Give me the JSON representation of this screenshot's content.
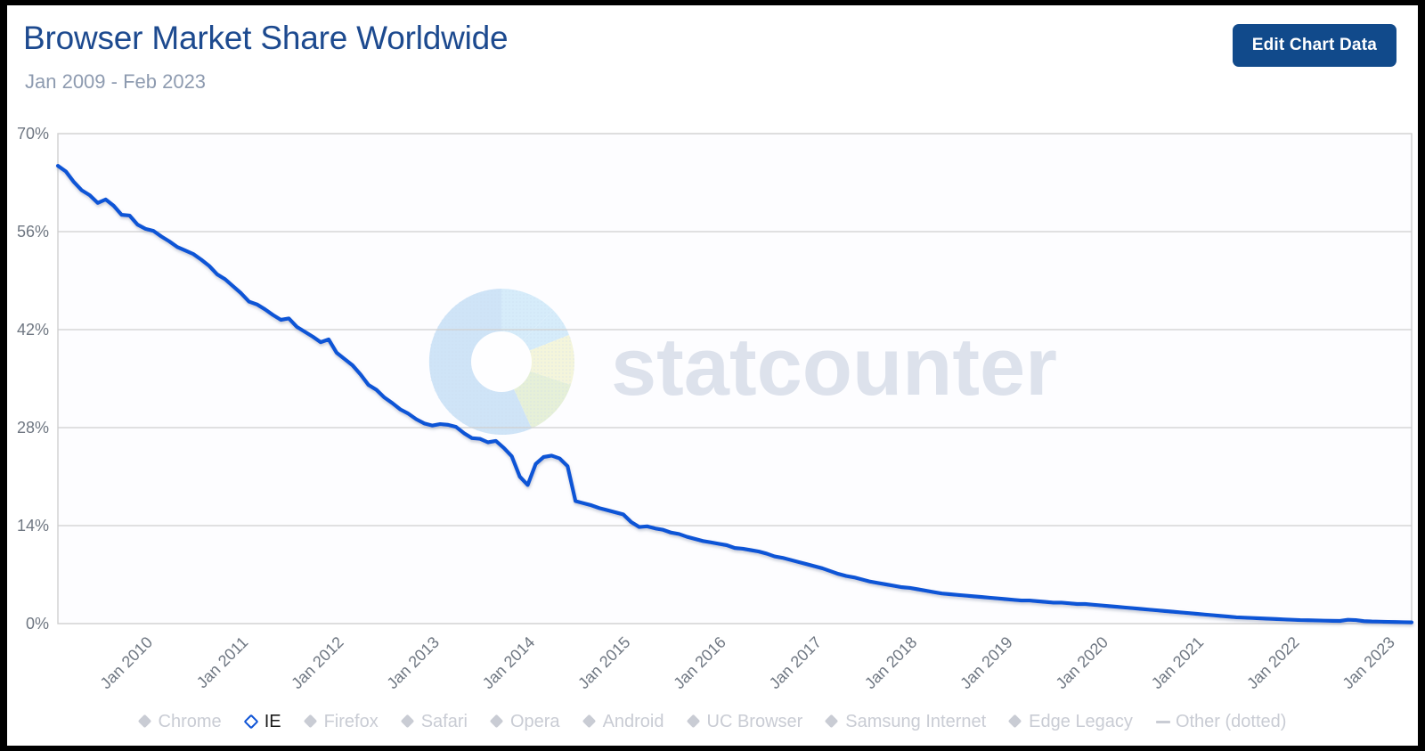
{
  "header": {
    "title": "Browser Market Share Worldwide",
    "subtitle": "Jan 2009 - Feb 2023",
    "edit_button_label": "Edit Chart Data"
  },
  "watermark": {
    "text": "statcounter"
  },
  "legend": {
    "items": [
      {
        "label": "Chrome",
        "marker": "diamond",
        "active": false
      },
      {
        "label": "IE",
        "marker": "diamond",
        "active": true
      },
      {
        "label": "Firefox",
        "marker": "diamond",
        "active": false
      },
      {
        "label": "Safari",
        "marker": "diamond",
        "active": false
      },
      {
        "label": "Opera",
        "marker": "diamond",
        "active": false
      },
      {
        "label": "Android",
        "marker": "diamond",
        "active": false
      },
      {
        "label": "UC Browser",
        "marker": "diamond",
        "active": false
      },
      {
        "label": "Samsung Internet",
        "marker": "diamond",
        "active": false
      },
      {
        "label": "Edge Legacy",
        "marker": "diamond",
        "active": false
      },
      {
        "label": "Other (dotted)",
        "marker": "dash",
        "active": false
      }
    ]
  },
  "colors": {
    "series_ie": "#0f54d6",
    "title": "#1d4a8f",
    "subtitle": "#8e9bb0",
    "button_bg": "#114a8b",
    "gridline": "#cfcfcf",
    "axis_text": "#6f7782",
    "legend_inactive": "#c9ccd4",
    "legend_active": "#1b1b1b",
    "plot_bg": "#fdfdff"
  },
  "chart_data": {
    "type": "line",
    "title": "Browser Market Share Worldwide",
    "subtitle": "Jan 2009 - Feb 2023",
    "xlabel": "",
    "ylabel": "",
    "ylim": [
      0,
      70
    ],
    "yticks": [
      "0%",
      "14%",
      "28%",
      "42%",
      "56%",
      "70%"
    ],
    "ytick_values": [
      0,
      14,
      28,
      42,
      56,
      70
    ],
    "xticks": [
      "Jan 2010",
      "Jan 2011",
      "Jan 2012",
      "Jan 2013",
      "Jan 2014",
      "Jan 2015",
      "Jan 2016",
      "Jan 2017",
      "Jan 2018",
      "Jan 2019",
      "Jan 2020",
      "Jan 2021",
      "Jan 2022",
      "Jan 2023"
    ],
    "grid": true,
    "legend_position": "bottom",
    "x_start": "Jan 2009",
    "x_end": "Feb 2023",
    "x_interval": "monthly",
    "series": [
      {
        "name": "IE",
        "color": "#0f54d6",
        "unit": "%",
        "x": [
          "2009-01",
          "2009-02",
          "2009-03",
          "2009-04",
          "2009-05",
          "2009-06",
          "2009-07",
          "2009-08",
          "2009-09",
          "2009-10",
          "2009-11",
          "2009-12",
          "2010-01",
          "2010-02",
          "2010-03",
          "2010-04",
          "2010-05",
          "2010-06",
          "2010-07",
          "2010-08",
          "2010-09",
          "2010-10",
          "2010-11",
          "2010-12",
          "2011-01",
          "2011-02",
          "2011-03",
          "2011-04",
          "2011-05",
          "2011-06",
          "2011-07",
          "2011-08",
          "2011-09",
          "2011-10",
          "2011-11",
          "2011-12",
          "2012-01",
          "2012-02",
          "2012-03",
          "2012-04",
          "2012-05",
          "2012-06",
          "2012-07",
          "2012-08",
          "2012-09",
          "2012-10",
          "2012-11",
          "2012-12",
          "2013-01",
          "2013-02",
          "2013-03",
          "2013-04",
          "2013-05",
          "2013-06",
          "2013-07",
          "2013-08",
          "2013-09",
          "2013-10",
          "2013-11",
          "2013-12",
          "2014-01",
          "2014-02",
          "2014-03",
          "2014-04",
          "2014-05",
          "2014-06",
          "2014-07",
          "2014-08",
          "2014-09",
          "2014-10",
          "2014-11",
          "2014-12",
          "2015-01",
          "2015-02",
          "2015-03",
          "2015-04",
          "2015-05",
          "2015-06",
          "2015-07",
          "2015-08",
          "2015-09",
          "2015-10",
          "2015-11",
          "2015-12",
          "2016-01",
          "2016-02",
          "2016-03",
          "2016-04",
          "2016-05",
          "2016-06",
          "2016-07",
          "2016-08",
          "2016-09",
          "2016-10",
          "2016-11",
          "2016-12",
          "2017-01",
          "2017-02",
          "2017-03",
          "2017-04",
          "2017-05",
          "2017-06",
          "2017-07",
          "2017-08",
          "2017-09",
          "2017-10",
          "2017-11",
          "2017-12",
          "2018-01",
          "2018-02",
          "2018-03",
          "2018-04",
          "2018-05",
          "2018-06",
          "2018-07",
          "2018-08",
          "2018-09",
          "2018-10",
          "2018-11",
          "2018-12",
          "2019-01",
          "2019-02",
          "2019-03",
          "2019-04",
          "2019-05",
          "2019-06",
          "2019-07",
          "2019-08",
          "2019-09",
          "2019-10",
          "2019-11",
          "2019-12",
          "2020-01",
          "2020-02",
          "2020-03",
          "2020-04",
          "2020-05",
          "2020-06",
          "2020-07",
          "2020-08",
          "2020-09",
          "2020-10",
          "2020-11",
          "2020-12",
          "2021-01",
          "2021-02",
          "2021-03",
          "2021-04",
          "2021-05",
          "2021-06",
          "2021-07",
          "2021-08",
          "2021-09",
          "2021-10",
          "2021-11",
          "2021-12",
          "2022-01",
          "2022-02",
          "2022-03",
          "2022-04",
          "2022-05",
          "2022-06",
          "2022-07",
          "2022-08",
          "2022-09",
          "2022-10",
          "2022-11",
          "2022-12",
          "2023-01",
          "2023-02"
        ],
        "values": [
          65.4,
          64.6,
          63.1,
          61.9,
          61.2,
          60.1,
          60.6,
          59.7,
          58.4,
          58.3,
          57.0,
          56.4,
          56.1,
          55.3,
          54.6,
          53.8,
          53.3,
          52.8,
          52.0,
          51.1,
          49.9,
          49.2,
          48.2,
          47.2,
          46.0,
          45.6,
          44.9,
          44.1,
          43.4,
          43.6,
          42.4,
          41.7,
          41.0,
          40.2,
          40.6,
          38.7,
          37.8,
          36.9,
          35.6,
          34.1,
          33.4,
          32.3,
          31.5,
          30.6,
          30.0,
          29.2,
          28.6,
          28.3,
          28.5,
          28.4,
          28.1,
          27.2,
          26.5,
          26.4,
          25.9,
          26.1,
          25.1,
          23.9,
          21.0,
          19.8,
          22.8,
          23.8,
          24.0,
          23.6,
          22.5,
          17.5,
          17.2,
          16.9,
          16.5,
          16.2,
          15.9,
          15.6,
          14.5,
          13.8,
          13.9,
          13.6,
          13.4,
          13.0,
          12.8,
          12.4,
          12.1,
          11.8,
          11.6,
          11.4,
          11.2,
          10.8,
          10.7,
          10.5,
          10.3,
          10.0,
          9.6,
          9.4,
          9.1,
          8.8,
          8.5,
          8.2,
          7.9,
          7.5,
          7.1,
          6.8,
          6.6,
          6.3,
          6.0,
          5.8,
          5.6,
          5.4,
          5.2,
          5.1,
          4.9,
          4.7,
          4.5,
          4.3,
          4.2,
          4.1,
          4.0,
          3.9,
          3.8,
          3.7,
          3.6,
          3.5,
          3.4,
          3.3,
          3.3,
          3.2,
          3.1,
          3.0,
          3.0,
          2.9,
          2.8,
          2.8,
          2.7,
          2.6,
          2.5,
          2.4,
          2.3,
          2.2,
          2.1,
          2.0,
          1.9,
          1.8,
          1.7,
          1.6,
          1.5,
          1.4,
          1.3,
          1.2,
          1.1,
          1.0,
          0.9,
          0.85,
          0.8,
          0.75,
          0.7,
          0.65,
          0.6,
          0.55,
          0.5,
          0.48,
          0.45,
          0.42,
          0.4,
          0.38,
          0.55,
          0.5,
          0.35,
          0.3,
          0.28,
          0.25,
          0.22,
          0.2,
          0.18
        ]
      }
    ]
  }
}
